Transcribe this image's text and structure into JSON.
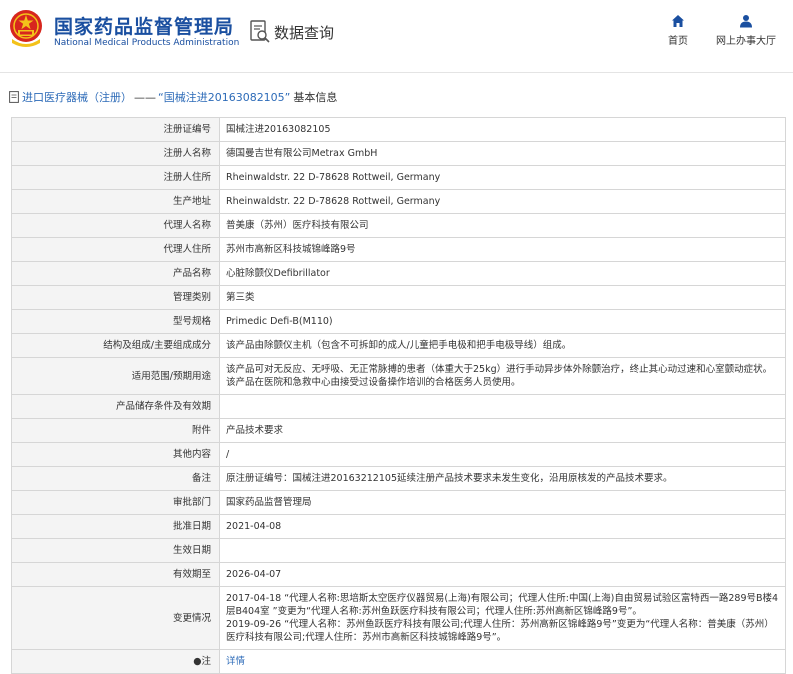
{
  "header": {
    "site_name_cn": "国家药品监督管理局",
    "site_name_en": "National Medical Products Administration",
    "query_label": "数据查询",
    "nav": {
      "home": "首页",
      "online_hall": "网上办事大厅"
    }
  },
  "breadcrumb": {
    "category": "进口医疗器械（注册）",
    "separator": "——",
    "record_title": "“国械注进20163082105”",
    "suffix": "基本信息"
  },
  "detail": {
    "rows": [
      {
        "label": "注册证编号",
        "value": "国械注进20163082105"
      },
      {
        "label": "注册人名称",
        "value": "德国曼吉世有限公司Metrax GmbH"
      },
      {
        "label": "注册人住所",
        "value": "Rheinwaldstr. 22 D-78628 Rottweil, Germany"
      },
      {
        "label": "生产地址",
        "value": "Rheinwaldstr. 22 D-78628 Rottweil, Germany"
      },
      {
        "label": "代理人名称",
        "value": "普美康（苏州）医疗科技有限公司"
      },
      {
        "label": "代理人住所",
        "value": "苏州市高新区科技城锦峰路9号"
      },
      {
        "label": "产品名称",
        "value": "心脏除颤仪Defibrillator"
      },
      {
        "label": "管理类别",
        "value": "第三类"
      },
      {
        "label": "型号规格",
        "value": "Primedic Defi-B(M110)"
      },
      {
        "label": "结构及组成/主要组成成分",
        "value": "该产品由除颤仪主机（包含不可拆卸的成人/儿童把手电极和把手电极导线）组成。"
      },
      {
        "label": "适用范围/预期用途",
        "value": "该产品可对无反应、无呼吸、无正常脉搏的患者（体重大于25kg）进行手动异步体外除颤治疗，终止其心动过速和心室颤动症状。该产品在医院和急救中心由接受过设备操作培训的合格医务人员使用。"
      },
      {
        "label": "产品储存条件及有效期",
        "value": ""
      },
      {
        "label": "附件",
        "value": "产品技术要求"
      },
      {
        "label": "其他内容",
        "value": "/"
      },
      {
        "label": "备注",
        "value": "原注册证编号：国械注进20163212105延续注册产品技术要求未发生变化，沿用原核发的产品技术要求。"
      },
      {
        "label": "审批部门",
        "value": "国家药品监督管理局"
      },
      {
        "label": "批准日期",
        "value": "2021-04-08"
      },
      {
        "label": "生效日期",
        "value": ""
      },
      {
        "label": "有效期至",
        "value": "2026-04-07"
      },
      {
        "label": "变更情况",
        "value": ""
      },
      {
        "label": "注",
        "value": "详情"
      }
    ],
    "changes": [
      "2017-04-18 “代理人名称:思培斯太空医疗仪器贸易(上海)有限公司；代理人住所:中国(上海)自由贸易试验区富特西一路289号B楼4层B404室 ”变更为“代理人名称:苏州鱼跃医疗科技有限公司；代理人住所:苏州高新区锦峰路9号”。",
      "2019-09-26 “代理人名称：苏州鱼跃医疗科技有限公司;代理人住所：苏州高新区锦峰路9号”变更为“代理人名称：普美康（苏州）医疗科技有限公司;代理人住所：苏州市高新区科技城锦峰路9号”。"
    ]
  }
}
